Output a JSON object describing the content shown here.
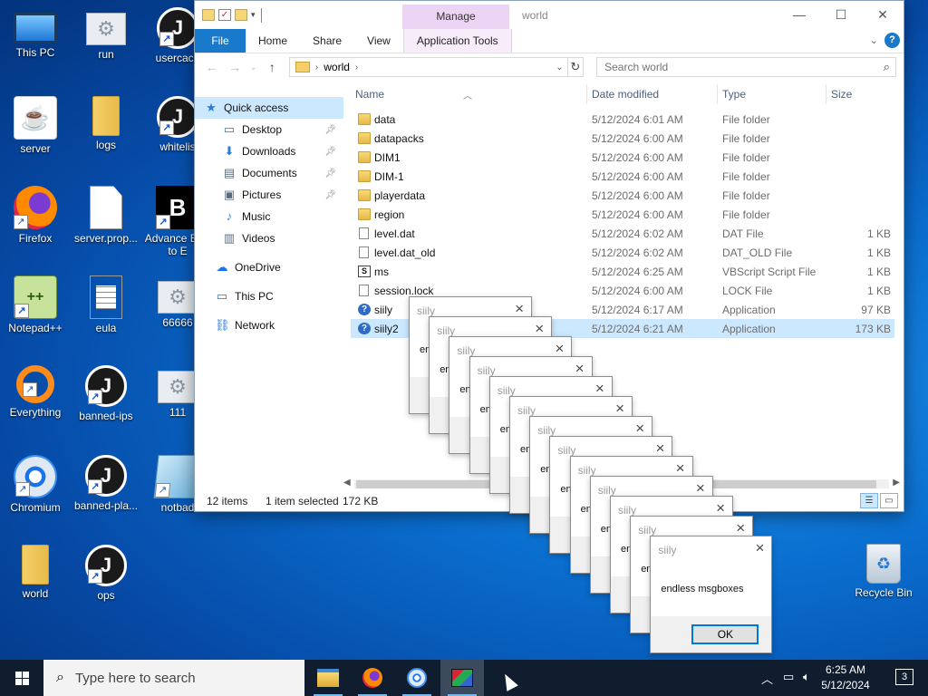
{
  "desktop": {
    "icons": [
      {
        "label": "This PC",
        "icon": "this-pc-icon"
      },
      {
        "label": "run",
        "icon": "settings-file-icon"
      },
      {
        "label": "usercach",
        "icon": "json-file-icon"
      },
      {
        "label": "server",
        "icon": "java-icon"
      },
      {
        "label": "logs",
        "icon": "folder-icon"
      },
      {
        "label": "whitelis",
        "icon": "json-file-icon"
      },
      {
        "label": "Firefox",
        "icon": "firefox-icon"
      },
      {
        "label": "server.prop...",
        "icon": "document-icon"
      },
      {
        "label": "Advance BAT to E",
        "icon": "bat-to-exe-icon"
      },
      {
        "label": "Notepad++",
        "icon": "notepadpp-icon"
      },
      {
        "label": "eula",
        "icon": "text-document-icon"
      },
      {
        "label": "66666",
        "icon": "settings-file-icon"
      },
      {
        "label": "Everything",
        "icon": "everything-search-icon"
      },
      {
        "label": "banned-ips",
        "icon": "json-file-icon"
      },
      {
        "label": "111",
        "icon": "settings-file-icon"
      },
      {
        "label": "Chromium",
        "icon": "chromium-icon"
      },
      {
        "label": "banned-pla...",
        "icon": "json-file-icon"
      },
      {
        "label": "notbad",
        "icon": "notebook-icon"
      },
      {
        "label": "world",
        "icon": "folder-icon"
      },
      {
        "label": "ops",
        "icon": "json-file-icon"
      },
      {
        "label": "Recycle Bin",
        "icon": "recycle-bin-icon"
      }
    ]
  },
  "explorer": {
    "title": "world",
    "manage_tab": "Manage",
    "ribbon_tabs": [
      "File",
      "Home",
      "Share",
      "View",
      "Application Tools"
    ],
    "address": {
      "path": "world"
    },
    "search_placeholder": "Search world",
    "nav": [
      {
        "label": "Quick access",
        "icon": "star-icon",
        "pinned": false
      },
      {
        "label": "Desktop",
        "icon": "desktop-icon",
        "pinned": true
      },
      {
        "label": "Downloads",
        "icon": "download-icon",
        "pinned": true
      },
      {
        "label": "Documents",
        "icon": "documents-icon",
        "pinned": true
      },
      {
        "label": "Pictures",
        "icon": "pictures-icon",
        "pinned": true
      },
      {
        "label": "Music",
        "icon": "music-icon",
        "pinned": false
      },
      {
        "label": "Videos",
        "icon": "videos-icon",
        "pinned": false
      },
      {
        "label": "OneDrive",
        "icon": "onedrive-icon",
        "pinned": false
      },
      {
        "label": "This PC",
        "icon": "this-pc-icon",
        "pinned": false
      },
      {
        "label": "Network",
        "icon": "network-icon",
        "pinned": false
      }
    ],
    "columns": [
      "Name",
      "Date modified",
      "Type",
      "Size"
    ],
    "files": [
      {
        "name": "data",
        "date": "5/12/2024 6:01 AM",
        "type": "File folder",
        "size": "",
        "icon": "folder"
      },
      {
        "name": "datapacks",
        "date": "5/12/2024 6:00 AM",
        "type": "File folder",
        "size": "",
        "icon": "folder"
      },
      {
        "name": "DIM1",
        "date": "5/12/2024 6:00 AM",
        "type": "File folder",
        "size": "",
        "icon": "folder"
      },
      {
        "name": "DIM-1",
        "date": "5/12/2024 6:00 AM",
        "type": "File folder",
        "size": "",
        "icon": "folder"
      },
      {
        "name": "playerdata",
        "date": "5/12/2024 6:00 AM",
        "type": "File folder",
        "size": "",
        "icon": "folder"
      },
      {
        "name": "region",
        "date": "5/12/2024 6:00 AM",
        "type": "File folder",
        "size": "",
        "icon": "folder"
      },
      {
        "name": "level.dat",
        "date": "5/12/2024 6:02 AM",
        "type": "DAT File",
        "size": "1 KB",
        "icon": "file"
      },
      {
        "name": "level.dat_old",
        "date": "5/12/2024 6:02 AM",
        "type": "DAT_OLD File",
        "size": "1 KB",
        "icon": "file"
      },
      {
        "name": "ms",
        "date": "5/12/2024 6:25 AM",
        "type": "VBScript Script File",
        "size": "1 KB",
        "icon": "vbs"
      },
      {
        "name": "session.lock",
        "date": "5/12/2024 6:00 AM",
        "type": "LOCK File",
        "size": "1 KB",
        "icon": "file"
      },
      {
        "name": "siily",
        "date": "5/12/2024 6:17 AM",
        "type": "Application",
        "size": "97 KB",
        "icon": "app"
      },
      {
        "name": "siily2",
        "date": "5/12/2024 6:21 AM",
        "type": "Application",
        "size": "173 KB",
        "icon": "app",
        "selected": true
      }
    ],
    "status": {
      "items": "12 items",
      "selection": "1 item selected",
      "size": "172 KB"
    }
  },
  "msgbox": {
    "title": "siily",
    "text": "endless msgboxes",
    "ok": "OK",
    "stack_count": 13,
    "partial_text": "en"
  },
  "taskbar": {
    "search_placeholder": "Type here to search",
    "apps": [
      "file-explorer-icon",
      "firefox-icon",
      "chromium-icon",
      "siily2-app-icon"
    ],
    "clock_time": "6:25 AM",
    "clock_date": "5/12/2024",
    "notifications": "3"
  }
}
